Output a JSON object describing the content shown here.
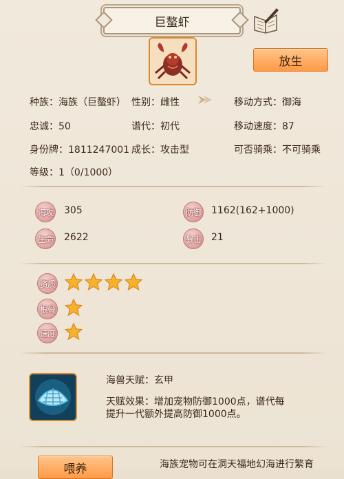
{
  "header": {
    "title": "巨螯虾"
  },
  "actions": {
    "release_label": "放生",
    "feed_label": "喂养"
  },
  "info": {
    "race_label": "种族：",
    "race_value": "海族（巨螯虾）",
    "gender_label": "性别：",
    "gender_value": "雌性",
    "move_type_label": "移动方式：",
    "move_type_value": "御海",
    "loyalty_label": "忠诚：",
    "loyalty_value": "50",
    "generation_label": "谱代：",
    "generation_value": "初代",
    "move_speed_label": "移动速度：",
    "move_speed_value": "87",
    "id_label": "身份牌：",
    "id_value": "1811247001",
    "growth_label": "成长：",
    "growth_value": "攻击型",
    "rideable_label": "可否骑乘：",
    "rideable_value": "不可骑乘",
    "level_label": "等级：",
    "level_value": "1（0/1000）"
  },
  "stats": {
    "attack_badge": "海攻",
    "attack_value": "305",
    "defense_badge": "防御",
    "defense_value": "1162(162+1000)",
    "life_badge": "生命",
    "life_value": "2622",
    "crit_badge": "暴击",
    "crit_value": "21"
  },
  "aptitude": {
    "quality_badge": "资质",
    "quality_stars": 4,
    "bone_badge": "根骨",
    "bone_stars": 1,
    "speed_badge": "速度",
    "speed_stars": 1
  },
  "talent": {
    "name_line": "海兽天赋：玄甲",
    "effect_line1": "天赋效果：增加宠物防御1000点，谱代每",
    "effect_line2": "提升一代额外提高防御1000点。"
  },
  "footer": {
    "note": "海族宠物可在洞天福地幻海进行繁育"
  },
  "colors": {
    "accent_orange": "#ff9a45",
    "badge_pink": "#e4a9a5",
    "star_gold": "#f5b22a"
  },
  "icons": {
    "book": "book-quill-icon",
    "arrow": "gender-arrow-icon",
    "star": "star-icon",
    "talent": "shell-icon"
  }
}
